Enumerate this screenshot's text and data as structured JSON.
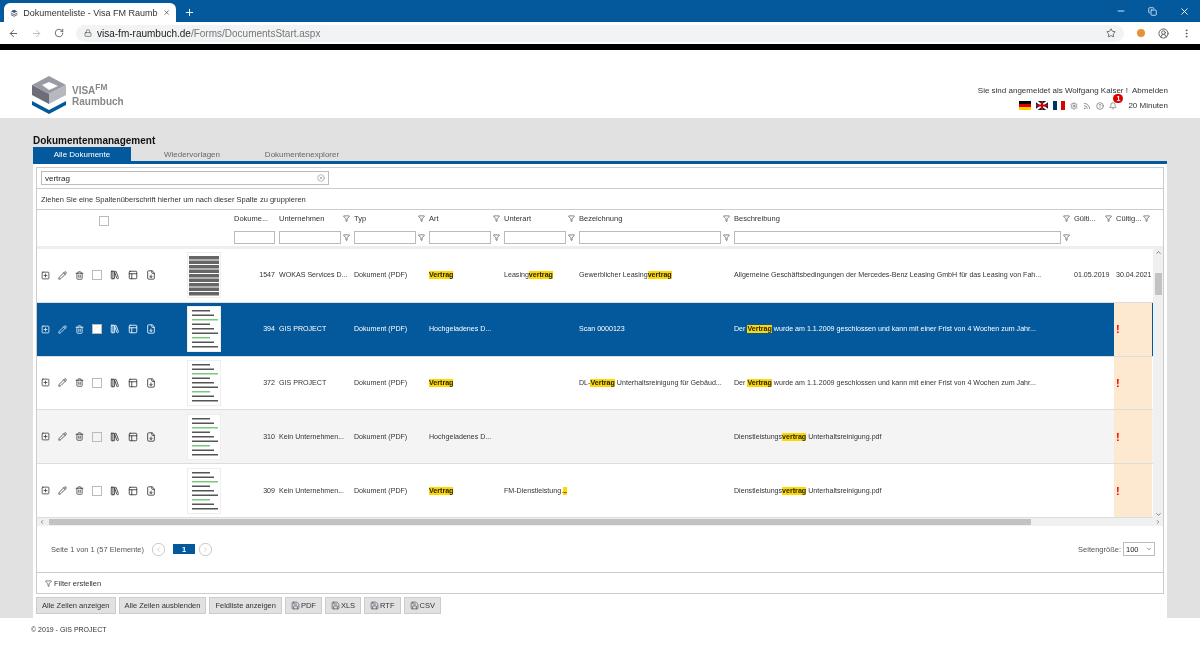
{
  "browser": {
    "tab_title": "Dokumenteliste - Visa FM Raumb",
    "url_host": "visa-fm-raumbuch.de",
    "url_path": "/Forms/DocumentsStart.aspx"
  },
  "header": {
    "logo_title": "VISA$^{FM}$",
    "logo_subtitle": "Raumbuch",
    "login_text": "Sie sind angemeldet als Wolfgang Kaiser !",
    "logout": "Abmelden",
    "notification_count": "1",
    "session_time": "20 Minuten"
  },
  "page_title": "Dokumentenmanagement",
  "tabs": [
    {
      "label": "Alle Dokumente",
      "selected": true
    },
    {
      "label": "Wiedervorlagen",
      "selected": false
    },
    {
      "label": "Dokumentenexplorer",
      "selected": false
    }
  ],
  "search": {
    "value": "vertrag"
  },
  "select_all": {
    "checked": false
  },
  "group_hint": "Ziehen Sie eine Spaltenüberschrift hierher um nach dieser Spalte zu gruppieren",
  "columns": [
    {
      "label": "Dokume...",
      "filter_icon": false,
      "filter_input": true
    },
    {
      "label": "Unternehmen",
      "filter_icon": true,
      "filter_input": true
    },
    {
      "label": "Typ",
      "filter_icon": true,
      "filter_input": true
    },
    {
      "label": "Art",
      "filter_icon": true,
      "filter_input": true
    },
    {
      "label": "Unterart",
      "filter_icon": true,
      "filter_input": true
    },
    {
      "label": "Bezeichnung",
      "filter_icon": true,
      "filter_input": true
    },
    {
      "label": "Beschreibung",
      "filter_icon": true,
      "filter_input": true
    },
    {
      "label": "Gülti...",
      "filter_icon": true,
      "filter_input": false
    },
    {
      "label": "Cültig...",
      "filter_icon": true,
      "filter_input": false
    }
  ],
  "rows": [
    {
      "selected": false,
      "cells": [
        "1547",
        "WOKAS Services D...",
        "Dokument (PDF)",
        "**Vertrag**",
        "Leasing**vertrag**",
        "Gewerblicher Leasing**vertrag**",
        "Allgemeine Geschäftsbedingungen der Mercedes-Benz Leasing GmbH für das Leasing von Fah...",
        "01.05.2019",
        "30.04.2021"
      ]
    },
    {
      "selected": true,
      "alert": "!",
      "cells": [
        "394",
        "GIS PROJECT",
        "Dokument (PDF)",
        "Hochgeladenes D...",
        "",
        "Scan 0000123",
        "Der **Vertrag** wurde am 1.1.2009 geschlossen und kann mit einer Frist von 4 Wochen zum Jahr...",
        "",
        ""
      ]
    },
    {
      "selected": false,
      "alert": "!",
      "cells": [
        "372",
        "GIS PROJECT",
        "Dokument (PDF)",
        "**Vertrag**",
        "",
        "DL-**Vertrag** Unterhaltsreinigung für Gebäud...",
        "Der **Vertrag** wurde am 1.1.2009 geschlossen und kann mit einer Frist von 4 Wochen zum Jahr...",
        "",
        ""
      ]
    },
    {
      "selected": false,
      "alert": "!",
      "cells": [
        "310",
        "Kein Unternehmen...",
        "Dokument (PDF)",
        "Hochgeladenes D...",
        "",
        "",
        "Dienstleistungs**vertrag** Unterhaltsreinigung.pdf",
        "",
        ""
      ]
    },
    {
      "selected": false,
      "alert": "!",
      "cells": [
        "309",
        "Kein Unternehmen...",
        "Dokument (PDF)",
        "**Vertrag**",
        "FM-Dienstleistung.**..**",
        "",
        "Dienstleistungs**vertrag** Unterhaltsreinigung.pdf",
        "",
        ""
      ]
    }
  ],
  "pager": {
    "summary": "Seite 1 von 1 (57 Elemente)",
    "pages": [
      {
        "label": "1",
        "selected": true
      }
    ],
    "page_size_label": "Seitengröße:",
    "page_size": "100"
  },
  "filter_link": "Filter erstellen",
  "buttons": [
    {
      "label": "Alle Zeilen anzeigen",
      "kind": "plain"
    },
    {
      "label": "Alle Zeilen ausblenden",
      "kind": "plain"
    },
    {
      "label": "Feldliste anzeigen",
      "kind": "plain"
    },
    {
      "label": "PDF",
      "kind": "export"
    },
    {
      "label": "XLS",
      "kind": "export"
    },
    {
      "label": "RTF",
      "kind": "export"
    },
    {
      "label": "CSV",
      "kind": "export"
    }
  ],
  "footer": "© 2019 - GIS PROJECT"
}
